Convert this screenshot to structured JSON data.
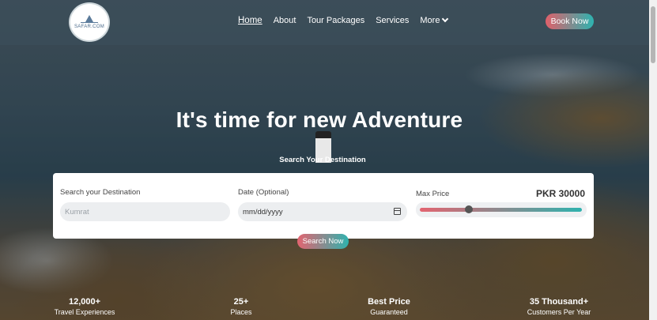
{
  "logo": {
    "text": "SAFAR.COM"
  },
  "nav": {
    "items": [
      {
        "label": "Home"
      },
      {
        "label": "About"
      },
      {
        "label": "Tour Packages"
      },
      {
        "label": "Services"
      },
      {
        "label": "More"
      }
    ],
    "book_label": "Book Now"
  },
  "hero": {
    "title": "It's time for new Adventure",
    "subtitle": "Search Your Destination"
  },
  "search": {
    "destination_label": "Search your Destination",
    "destination_placeholder": "Kumrat",
    "date_label": "Date (Optional)",
    "date_value": "mm/dd/yyyy",
    "price_label": "Max Price",
    "price_value": "PKR 30000",
    "price_slider_fraction": 0.3,
    "button_label": "Search Now"
  },
  "stats": [
    {
      "value": "12,000+",
      "label": "Travel Experiences"
    },
    {
      "value": "25+",
      "label": "Places"
    },
    {
      "value": "Best Price",
      "label": "Guaranteed"
    },
    {
      "value": "35 Thousand+",
      "label": "Customers Per Year"
    }
  ],
  "colors": {
    "accent_start": "#e36470",
    "accent_end": "#2fb2ae"
  }
}
